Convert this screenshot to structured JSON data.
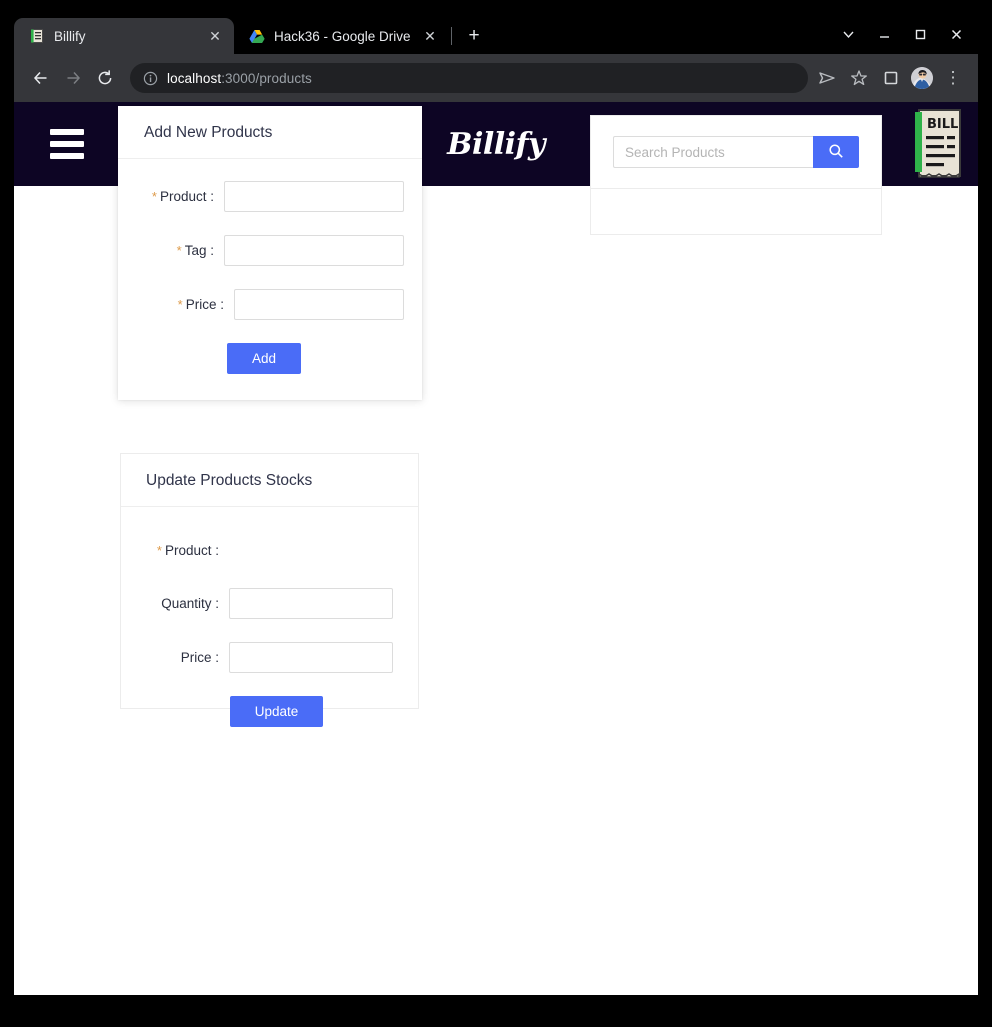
{
  "browser": {
    "tabs": [
      {
        "title": "Billify",
        "favicon": "bill-receipt-icon",
        "active": true,
        "close_label": "✕"
      },
      {
        "title": "Hack36 - Google Drive",
        "favicon": "google-drive-icon",
        "active": false,
        "close_label": "✕"
      }
    ],
    "new_tab_label": "+",
    "window_controls": {
      "tab_search_label": "∨",
      "minimize_label": "—",
      "maximize_label": "☐",
      "close_label": "✕"
    },
    "toolbar": {
      "back_label": "←",
      "forward_label": "→",
      "reload_label": "⟳",
      "info_icon": "info-circle-icon",
      "url_host": "localhost",
      "url_path": ":3000/products",
      "share_icon": "send-arrow-icon",
      "bookmark_icon": "star-icon",
      "sidepanel_icon": "square-panel-icon",
      "avatar_icon": "profile-avatar",
      "menu_label": "⋮"
    }
  },
  "app": {
    "header": {
      "menu_icon": "hamburger-menu-icon",
      "brand": "Billify",
      "logo_icon": "bill-receipt-logo",
      "logo_text": "BILL $",
      "background": "#0d0524"
    },
    "add_products_card": {
      "title": "Add New Products",
      "fields": [
        {
          "label": "Product :",
          "required": true,
          "value": "",
          "placeholder": ""
        },
        {
          "label": "Tag :",
          "required": true,
          "value": "",
          "placeholder": ""
        },
        {
          "label": "Price :",
          "required": true,
          "value": "",
          "placeholder": ""
        }
      ],
      "submit_label": "Add"
    },
    "update_stocks_card": {
      "title": "Update Products Stocks",
      "fields": [
        {
          "label": "Product :",
          "required": true,
          "value": "",
          "placeholder": "",
          "has_input": false
        },
        {
          "label": "Quantity :",
          "required": false,
          "value": "",
          "placeholder": "",
          "has_input": true
        },
        {
          "label": "Price :",
          "required": false,
          "value": "",
          "placeholder": "",
          "has_input": true
        }
      ],
      "submit_label": "Update"
    },
    "search_card": {
      "placeholder": "Search Products",
      "value": "",
      "search_icon": "magnifier-icon",
      "results": []
    },
    "colors": {
      "primary": "#4a6cf7",
      "header_bg": "#0d0524",
      "required_star": "#dd9a4a",
      "text": "#2c3040"
    }
  }
}
